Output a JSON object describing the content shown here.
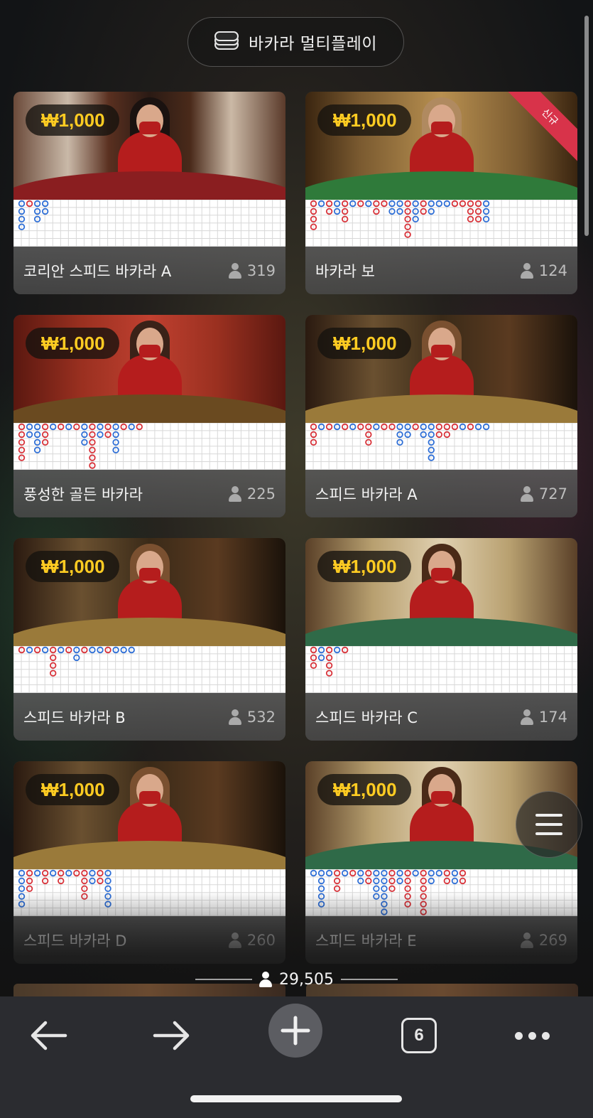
{
  "header": {
    "title": "바카라 멀티플레이",
    "icon": "chips-stack-icon"
  },
  "tables": [
    {
      "price": "₩1,000",
      "title": "코리안 스피드 바카라 A",
      "players": "319",
      "new_badge": "",
      "scene": "korean"
    },
    {
      "price": "₩1,000",
      "title": "바카라 보",
      "players": "124",
      "new_badge": "신규",
      "scene": "green"
    },
    {
      "price": "₩1,000",
      "title": "풍성한 골든 바카라",
      "players": "225",
      "new_badge": "",
      "scene": "dragon"
    },
    {
      "price": "₩1,000",
      "title": "스피드 바카라 A",
      "players": "727",
      "new_badge": "",
      "scene": "gold"
    },
    {
      "price": "₩1,000",
      "title": "스피드 바카라 B",
      "players": "532",
      "new_badge": "",
      "scene": "gold"
    },
    {
      "price": "₩1,000",
      "title": "스피드 바카라 C",
      "players": "174",
      "new_badge": "",
      "scene": "greentable"
    },
    {
      "price": "₩1,000",
      "title": "스피드 바카라 D",
      "players": "260",
      "new_badge": "",
      "scene": "gold"
    },
    {
      "price": "₩1,000",
      "title": "스피드 바카라 E",
      "players": "269",
      "new_badge": "",
      "scene": "greentable"
    }
  ],
  "total_players": "29,505",
  "menu_button": {
    "icon": "hamburger-menu-icon"
  },
  "toolbar": {
    "back_icon": "back-arrow-icon",
    "forward_icon": "forward-arrow-icon",
    "add_icon": "plus-icon",
    "tab_count": "6",
    "more_icon": "more-dots-icon"
  },
  "colors": {
    "price": "#ffcc22",
    "player_circle": "#2f6fd6",
    "banker_circle": "#d8333a",
    "tie": "#3aa64a",
    "new_ribbon": "#d8334a"
  }
}
